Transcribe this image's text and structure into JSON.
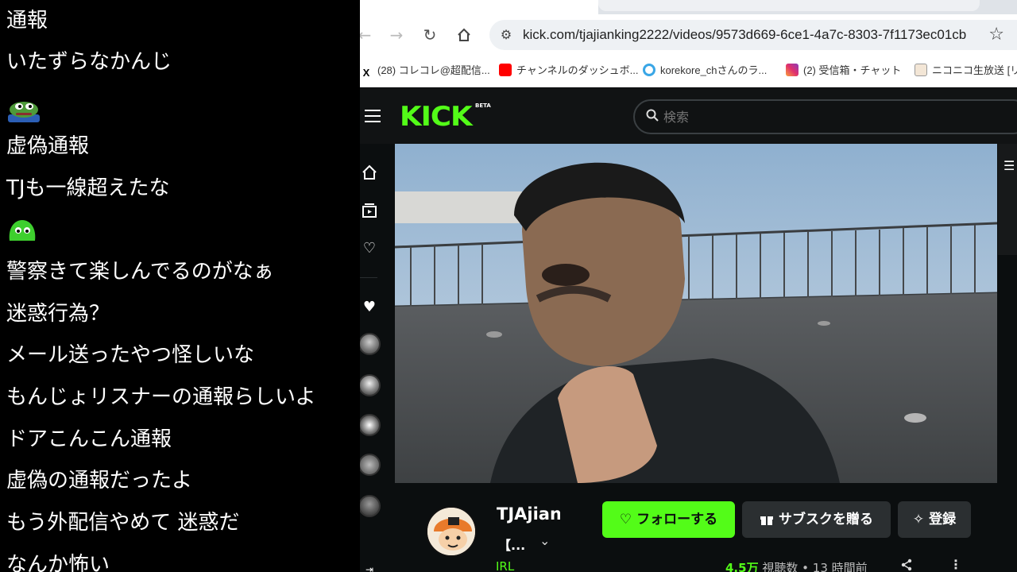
{
  "chat": {
    "messages": [
      "通報",
      "いたずらなかんじ",
      "虚偽通報",
      "TJも一線超えたな",
      "警察きて楽しんでるのがなぁ",
      "迷惑行為？",
      "メール送ったやつ怪しいな",
      "もんじょリスナーの通報らしいよ",
      "ドアこんこん通報",
      "虚偽の通報だったよ",
      "もう外配信やめて 迷惑だ",
      "なんか怖い"
    ]
  },
  "browser": {
    "url": "kick.com/tjajianking2222/videos/9573d669-6ce1-4a7c-8303-7f1173ec01cb",
    "bookmarks": [
      {
        "label": "(28) コレコレ@超配信...",
        "icon": "x-icon"
      },
      {
        "label": "チャンネルのダッシュボ...",
        "icon": "youtube-icon"
      },
      {
        "label": "korekore_chさんのラ...",
        "icon": "twitcasting-icon"
      },
      {
        "label": "(2) 受信箱・チャット",
        "icon": "instagram-icon"
      },
      {
        "label": "ニコニコ生放送 [リ",
        "icon": "niconico-icon"
      }
    ],
    "colors": {
      "accent": "#53fc18",
      "background": "#0b0e0f"
    }
  },
  "kick": {
    "logo": "KICK",
    "beta": "BETA",
    "search_placeholder": "検索",
    "channel": {
      "name": "TJAjian",
      "subtitle": "【...",
      "category": "IRL",
      "follow_label": "フォローする",
      "gift_label": "サブスクを贈る",
      "subscribe_label": "登録",
      "views_number": "4.5万",
      "views_label": "視聴数",
      "time": "13 時間前"
    }
  }
}
